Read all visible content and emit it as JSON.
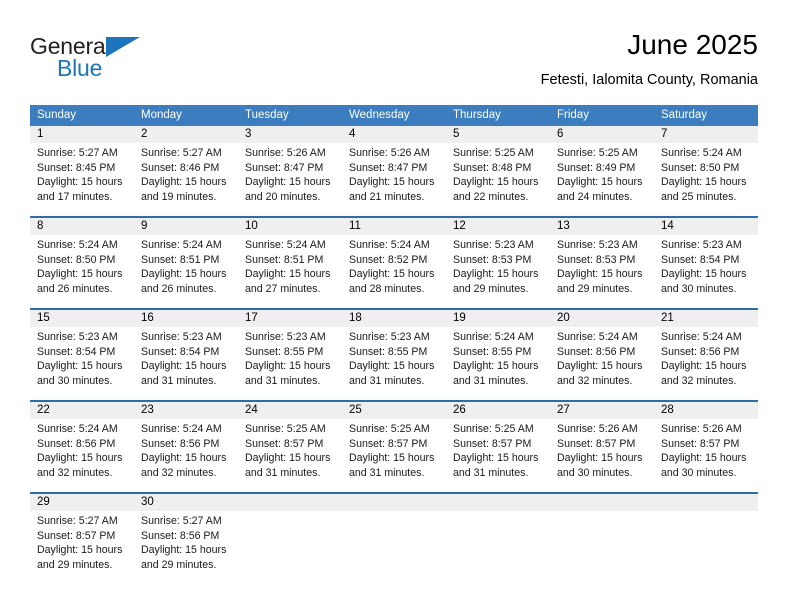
{
  "brand": {
    "name_top": "General",
    "name_bottom": "Blue",
    "triangle_color": "#1c75bc"
  },
  "header": {
    "title": "June 2025",
    "subtitle": "Fetesti, Ialomita County, Romania"
  },
  "calendar": {
    "header_bg": "#3b7dbf",
    "row_divider": "#2d6da8",
    "daynum_bg": "#efefef",
    "weekdays": [
      "Sunday",
      "Monday",
      "Tuesday",
      "Wednesday",
      "Thursday",
      "Friday",
      "Saturday"
    ],
    "weeks": [
      [
        {
          "day": "1",
          "sunrise": "Sunrise: 5:27 AM",
          "sunset": "Sunset: 8:45 PM",
          "daylight_line1": "Daylight: 15 hours",
          "daylight_line2": "and 17 minutes."
        },
        {
          "day": "2",
          "sunrise": "Sunrise: 5:27 AM",
          "sunset": "Sunset: 8:46 PM",
          "daylight_line1": "Daylight: 15 hours",
          "daylight_line2": "and 19 minutes."
        },
        {
          "day": "3",
          "sunrise": "Sunrise: 5:26 AM",
          "sunset": "Sunset: 8:47 PM",
          "daylight_line1": "Daylight: 15 hours",
          "daylight_line2": "and 20 minutes."
        },
        {
          "day": "4",
          "sunrise": "Sunrise: 5:26 AM",
          "sunset": "Sunset: 8:47 PM",
          "daylight_line1": "Daylight: 15 hours",
          "daylight_line2": "and 21 minutes."
        },
        {
          "day": "5",
          "sunrise": "Sunrise: 5:25 AM",
          "sunset": "Sunset: 8:48 PM",
          "daylight_line1": "Daylight: 15 hours",
          "daylight_line2": "and 22 minutes."
        },
        {
          "day": "6",
          "sunrise": "Sunrise: 5:25 AM",
          "sunset": "Sunset: 8:49 PM",
          "daylight_line1": "Daylight: 15 hours",
          "daylight_line2": "and 24 minutes."
        },
        {
          "day": "7",
          "sunrise": "Sunrise: 5:24 AM",
          "sunset": "Sunset: 8:50 PM",
          "daylight_line1": "Daylight: 15 hours",
          "daylight_line2": "and 25 minutes."
        }
      ],
      [
        {
          "day": "8",
          "sunrise": "Sunrise: 5:24 AM",
          "sunset": "Sunset: 8:50 PM",
          "daylight_line1": "Daylight: 15 hours",
          "daylight_line2": "and 26 minutes."
        },
        {
          "day": "9",
          "sunrise": "Sunrise: 5:24 AM",
          "sunset": "Sunset: 8:51 PM",
          "daylight_line1": "Daylight: 15 hours",
          "daylight_line2": "and 26 minutes."
        },
        {
          "day": "10",
          "sunrise": "Sunrise: 5:24 AM",
          "sunset": "Sunset: 8:51 PM",
          "daylight_line1": "Daylight: 15 hours",
          "daylight_line2": "and 27 minutes."
        },
        {
          "day": "11",
          "sunrise": "Sunrise: 5:24 AM",
          "sunset": "Sunset: 8:52 PM",
          "daylight_line1": "Daylight: 15 hours",
          "daylight_line2": "and 28 minutes."
        },
        {
          "day": "12",
          "sunrise": "Sunrise: 5:23 AM",
          "sunset": "Sunset: 8:53 PM",
          "daylight_line1": "Daylight: 15 hours",
          "daylight_line2": "and 29 minutes."
        },
        {
          "day": "13",
          "sunrise": "Sunrise: 5:23 AM",
          "sunset": "Sunset: 8:53 PM",
          "daylight_line1": "Daylight: 15 hours",
          "daylight_line2": "and 29 minutes."
        },
        {
          "day": "14",
          "sunrise": "Sunrise: 5:23 AM",
          "sunset": "Sunset: 8:54 PM",
          "daylight_line1": "Daylight: 15 hours",
          "daylight_line2": "and 30 minutes."
        }
      ],
      [
        {
          "day": "15",
          "sunrise": "Sunrise: 5:23 AM",
          "sunset": "Sunset: 8:54 PM",
          "daylight_line1": "Daylight: 15 hours",
          "daylight_line2": "and 30 minutes."
        },
        {
          "day": "16",
          "sunrise": "Sunrise: 5:23 AM",
          "sunset": "Sunset: 8:54 PM",
          "daylight_line1": "Daylight: 15 hours",
          "daylight_line2": "and 31 minutes."
        },
        {
          "day": "17",
          "sunrise": "Sunrise: 5:23 AM",
          "sunset": "Sunset: 8:55 PM",
          "daylight_line1": "Daylight: 15 hours",
          "daylight_line2": "and 31 minutes."
        },
        {
          "day": "18",
          "sunrise": "Sunrise: 5:23 AM",
          "sunset": "Sunset: 8:55 PM",
          "daylight_line1": "Daylight: 15 hours",
          "daylight_line2": "and 31 minutes."
        },
        {
          "day": "19",
          "sunrise": "Sunrise: 5:24 AM",
          "sunset": "Sunset: 8:55 PM",
          "daylight_line1": "Daylight: 15 hours",
          "daylight_line2": "and 31 minutes."
        },
        {
          "day": "20",
          "sunrise": "Sunrise: 5:24 AM",
          "sunset": "Sunset: 8:56 PM",
          "daylight_line1": "Daylight: 15 hours",
          "daylight_line2": "and 32 minutes."
        },
        {
          "day": "21",
          "sunrise": "Sunrise: 5:24 AM",
          "sunset": "Sunset: 8:56 PM",
          "daylight_line1": "Daylight: 15 hours",
          "daylight_line2": "and 32 minutes."
        }
      ],
      [
        {
          "day": "22",
          "sunrise": "Sunrise: 5:24 AM",
          "sunset": "Sunset: 8:56 PM",
          "daylight_line1": "Daylight: 15 hours",
          "daylight_line2": "and 32 minutes."
        },
        {
          "day": "23",
          "sunrise": "Sunrise: 5:24 AM",
          "sunset": "Sunset: 8:56 PM",
          "daylight_line1": "Daylight: 15 hours",
          "daylight_line2": "and 32 minutes."
        },
        {
          "day": "24",
          "sunrise": "Sunrise: 5:25 AM",
          "sunset": "Sunset: 8:57 PM",
          "daylight_line1": "Daylight: 15 hours",
          "daylight_line2": "and 31 minutes."
        },
        {
          "day": "25",
          "sunrise": "Sunrise: 5:25 AM",
          "sunset": "Sunset: 8:57 PM",
          "daylight_line1": "Daylight: 15 hours",
          "daylight_line2": "and 31 minutes."
        },
        {
          "day": "26",
          "sunrise": "Sunrise: 5:25 AM",
          "sunset": "Sunset: 8:57 PM",
          "daylight_line1": "Daylight: 15 hours",
          "daylight_line2": "and 31 minutes."
        },
        {
          "day": "27",
          "sunrise": "Sunrise: 5:26 AM",
          "sunset": "Sunset: 8:57 PM",
          "daylight_line1": "Daylight: 15 hours",
          "daylight_line2": "and 30 minutes."
        },
        {
          "day": "28",
          "sunrise": "Sunrise: 5:26 AM",
          "sunset": "Sunset: 8:57 PM",
          "daylight_line1": "Daylight: 15 hours",
          "daylight_line2": "and 30 minutes."
        }
      ],
      [
        {
          "day": "29",
          "sunrise": "Sunrise: 5:27 AM",
          "sunset": "Sunset: 8:57 PM",
          "daylight_line1": "Daylight: 15 hours",
          "daylight_line2": "and 29 minutes."
        },
        {
          "day": "30",
          "sunrise": "Sunrise: 5:27 AM",
          "sunset": "Sunset: 8:56 PM",
          "daylight_line1": "Daylight: 15 hours",
          "daylight_line2": "and 29 minutes."
        },
        {
          "day": "",
          "sunrise": "",
          "sunset": "",
          "daylight_line1": "",
          "daylight_line2": ""
        },
        {
          "day": "",
          "sunrise": "",
          "sunset": "",
          "daylight_line1": "",
          "daylight_line2": ""
        },
        {
          "day": "",
          "sunrise": "",
          "sunset": "",
          "daylight_line1": "",
          "daylight_line2": ""
        },
        {
          "day": "",
          "sunrise": "",
          "sunset": "",
          "daylight_line1": "",
          "daylight_line2": ""
        },
        {
          "day": "",
          "sunrise": "",
          "sunset": "",
          "daylight_line1": "",
          "daylight_line2": ""
        }
      ]
    ]
  }
}
